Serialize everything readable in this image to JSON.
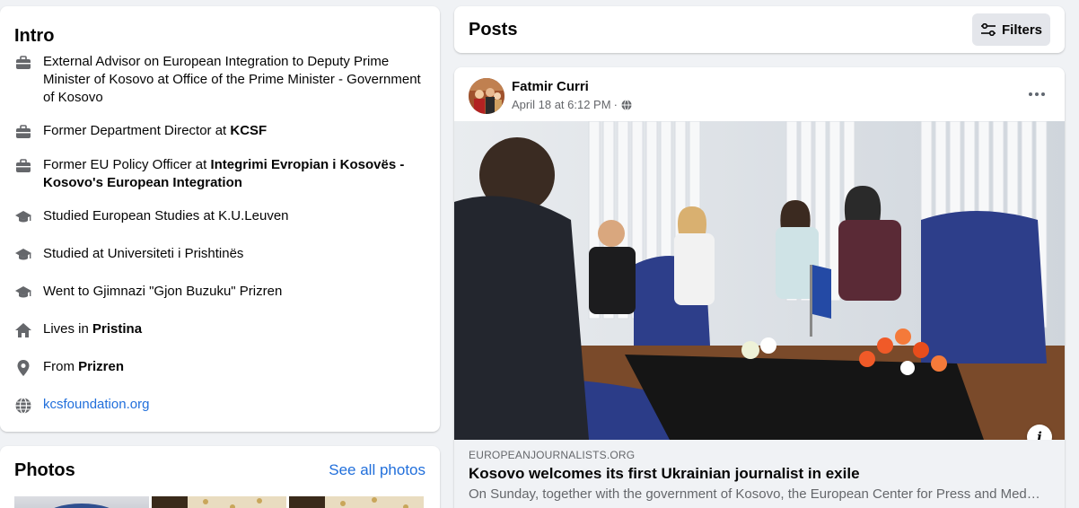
{
  "intro": {
    "title": "Intro",
    "items": [
      {
        "icon": "briefcase-icon",
        "parts": [
          "External Advisor on European Integration to Deputy Prime Minister of Kosovo at Office of the Prime Minister - Government of Kosovo"
        ]
      },
      {
        "icon": "briefcase-icon",
        "text": "Former Department Director at ",
        "bold": "KCSF"
      },
      {
        "icon": "briefcase-icon",
        "text": "Former EU Policy Officer at ",
        "bold": "Integrimi Evropian i Kosovës - Kosovo's European Integration"
      },
      {
        "icon": "graduation-cap-icon",
        "text": "Studied European Studies at K.U.Leuven"
      },
      {
        "icon": "graduation-cap-icon",
        "text": "Studied at Universiteti i Prishtinës"
      },
      {
        "icon": "graduation-cap-icon",
        "text": "Went to Gjimnazi \"Gjon Buzuku\" Prizren"
      },
      {
        "icon": "home-icon",
        "text": "Lives in ",
        "bold": "Pristina"
      },
      {
        "icon": "location-pin-icon",
        "text": "From ",
        "bold": "Prizren"
      },
      {
        "icon": "globe-icon",
        "link": "kcsfoundation.org"
      }
    ]
  },
  "photos": {
    "title": "Photos",
    "see_all": "See all photos"
  },
  "posts": {
    "title": "Posts",
    "filters_label": "Filters"
  },
  "post": {
    "author": "Fatmir Curri",
    "timestamp": "April 18 at 6:12 PM",
    "separator": "·",
    "privacy_icon": "globe-icon",
    "preview": {
      "domain": "EUROPEANJOURNALISTS.ORG",
      "headline": "Kosovo welcomes its first Ukrainian journalist in exile",
      "description": "On Sunday, together with the government of Kosovo, the European Center for Press and Media Freedom"
    },
    "info_glyph": "i"
  },
  "colors": {
    "link": "#216fdb",
    "secondary_text": "#65676b",
    "background": "#f0f2f5"
  }
}
